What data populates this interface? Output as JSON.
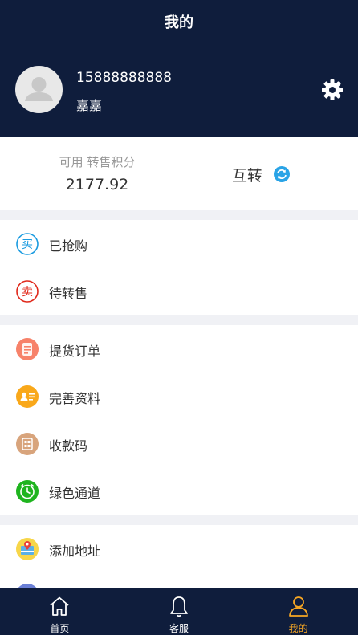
{
  "header": {
    "title": "我的",
    "phone": "15888888888",
    "nickname": "嘉嘉"
  },
  "points": {
    "label": "可用 转售积分",
    "value": "2177.92",
    "transfer_label": "互转"
  },
  "menu_groups": {
    "purchase": [
      {
        "label": "已抢购",
        "icon": "buy-icon",
        "color": "#1a9be0"
      },
      {
        "label": "待转售",
        "icon": "sell-icon",
        "color": "#e0281a"
      }
    ],
    "account": [
      {
        "label": "提货订单",
        "icon": "order-icon",
        "color": "#f7826a"
      },
      {
        "label": "完善资料",
        "icon": "profile-card-icon",
        "color": "#f9a81a"
      },
      {
        "label": "收款码",
        "icon": "qr-code-icon",
        "color": "#d8a47c"
      },
      {
        "label": "绿色通道",
        "icon": "clock-icon",
        "color": "#1fb41f"
      }
    ],
    "address": [
      {
        "label": "添加地址",
        "icon": "map-icon",
        "color": "#f7d64a"
      }
    ]
  },
  "tabbar": {
    "home": "首页",
    "service": "客服",
    "mine": "我的",
    "active_color": "#f6a623"
  },
  "colors": {
    "header_bg": "#0f1d3c",
    "accent": "#f6a623"
  }
}
